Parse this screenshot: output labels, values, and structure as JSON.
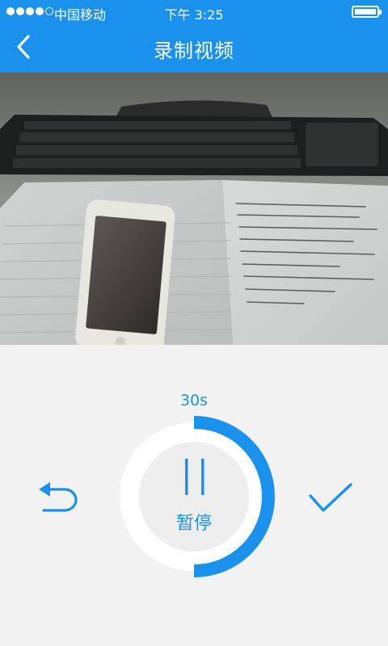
{
  "status_bar": {
    "carrier": "中国移动",
    "time": "下午 3:25",
    "signal_bars": 4,
    "signal_max": 5,
    "battery_level": 1.0
  },
  "header": {
    "title": "录制视频",
    "back_icon": "chevron-left-icon"
  },
  "recorder": {
    "remaining_time": "30s",
    "progress": 0.5,
    "pause_label": "暂停",
    "pause_icon": "pause-icon",
    "undo_icon": "undo-icon",
    "confirm_icon": "check-icon"
  },
  "colors": {
    "accent": "#1a92ed",
    "background": "#f2f2f2",
    "ring_track": "#ffffff",
    "pause_button": "#eeeeee"
  }
}
